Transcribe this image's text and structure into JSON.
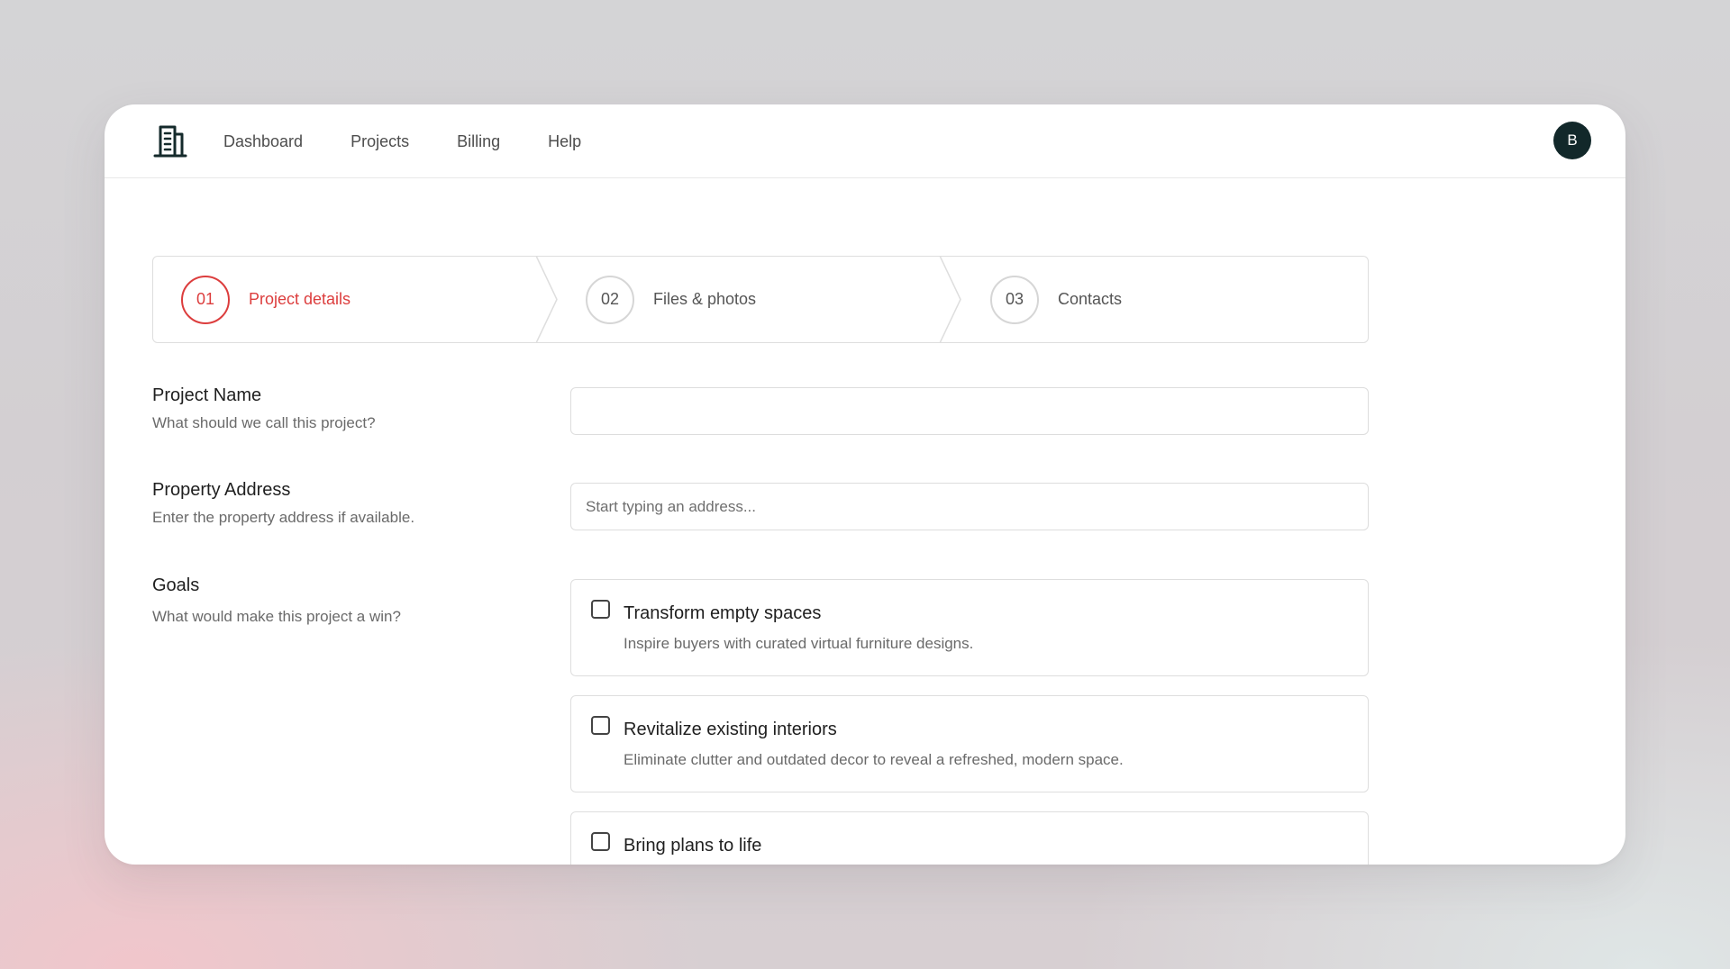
{
  "nav": {
    "logo_icon": "building-icon",
    "links": [
      "Dashboard",
      "Projects",
      "Billing",
      "Help"
    ],
    "avatar_initial": "B"
  },
  "steps": [
    {
      "number": "01",
      "label": "Project details",
      "active": true
    },
    {
      "number": "02",
      "label": "Files & photos",
      "active": false
    },
    {
      "number": "03",
      "label": "Contacts",
      "active": false
    }
  ],
  "form": {
    "project_name": {
      "title": "Project Name",
      "description": "What should we call this project?",
      "value": "",
      "placeholder": ""
    },
    "property_address": {
      "title": "Property Address",
      "description": "Enter the property address if available.",
      "value": "",
      "placeholder": "Start typing an address..."
    },
    "goals": {
      "title": "Goals",
      "description": "What would make this project a win?",
      "options": [
        {
          "title": "Transform empty spaces",
          "description": "Inspire buyers with curated virtual furniture designs.",
          "checked": false
        },
        {
          "title": "Revitalize existing interiors",
          "description": "Eliminate clutter and outdated decor to reveal a refreshed, modern space.",
          "checked": false
        },
        {
          "title": "Bring plans to life",
          "description": "",
          "checked": false
        }
      ]
    }
  },
  "colors": {
    "accent": "#dc3d3d",
    "avatar_bg": "#12282a",
    "border": "#dedede"
  }
}
